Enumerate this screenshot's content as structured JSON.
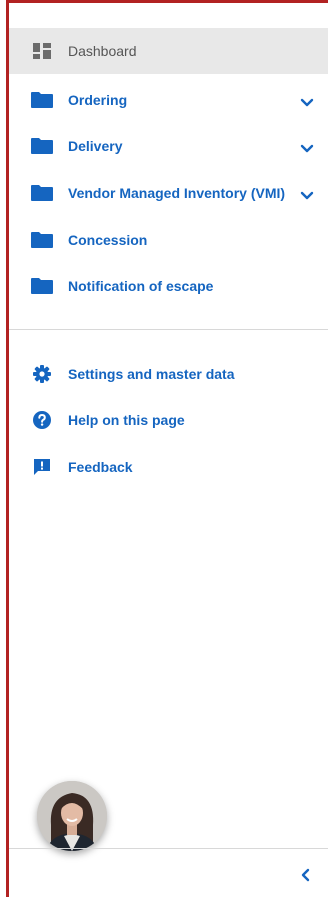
{
  "nav": {
    "dashboard": "Dashboard",
    "ordering": "Ordering",
    "delivery": "Delivery",
    "vmi": "Vendor Managed Inventory (VMI)",
    "concession": "Concession",
    "escape": "Notification of escape"
  },
  "secondary": {
    "settings": "Settings and master data",
    "help": "Help on this page",
    "feedback": "Feedback"
  },
  "colors": {
    "accent": "#1565c0",
    "active_bg": "#e8e8e8",
    "frame": "#b22222"
  },
  "icons": {
    "dashboard": "dashboard-icon",
    "folder": "folder-icon",
    "settings": "gear-icon",
    "help": "help-icon",
    "feedback": "feedback-icon",
    "expand": "chevron-down-icon",
    "collapse": "chevron-left-icon"
  }
}
